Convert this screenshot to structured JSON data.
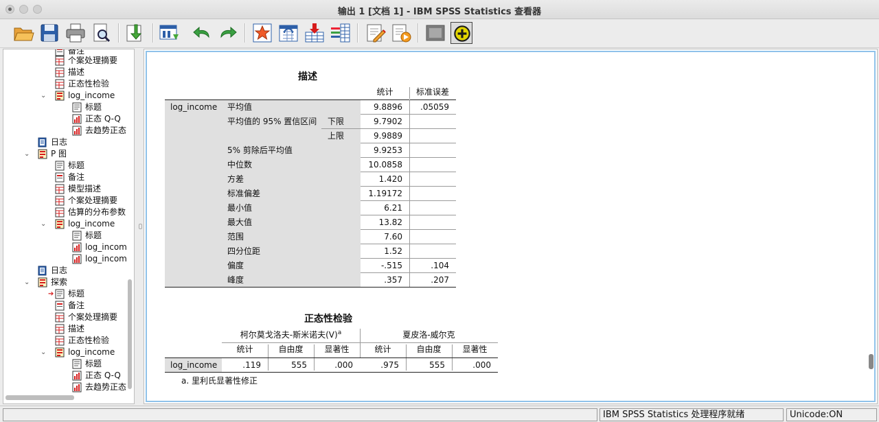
{
  "window": {
    "title": "输出 1 [文档 1] - IBM SPSS Statistics 查看器"
  },
  "toolbar": {
    "buttons": [
      "open-icon",
      "save-icon",
      "print-icon",
      "print-preview-icon",
      "export-icon",
      "goto-data-icon",
      "undo-icon",
      "redo-icon",
      "goto-case-icon",
      "goto-variable-icon",
      "insert-cases-icon",
      "variables-icon",
      "script-icon",
      "run-script-icon",
      "designate-window-icon",
      "add-icon"
    ]
  },
  "navigator": {
    "nodes": [
      {
        "label": "备注"
      },
      {
        "label": "个案处理摘要"
      },
      {
        "label": "描述"
      },
      {
        "label": "正态性检验"
      },
      {
        "label": "log_income"
      },
      {
        "label": "标题"
      },
      {
        "label": "正态 Q-Q"
      },
      {
        "label": "去趋势正态"
      },
      {
        "label": "日志"
      },
      {
        "label": "P 图"
      },
      {
        "label": "标题"
      },
      {
        "label": "备注"
      },
      {
        "label": "模型描述"
      },
      {
        "label": "个案处理摘要"
      },
      {
        "label": "估算的分布参数"
      },
      {
        "label": "log_income"
      },
      {
        "label": "标题"
      },
      {
        "label": "log_incom"
      },
      {
        "label": "log_incom"
      },
      {
        "label": "日志"
      },
      {
        "label": "探索"
      },
      {
        "label": "标题"
      },
      {
        "label": "备注"
      },
      {
        "label": "个案处理摘要"
      },
      {
        "label": "描述"
      },
      {
        "label": "正态性检验"
      },
      {
        "label": "log_income"
      },
      {
        "label": "标题"
      },
      {
        "label": "正态 Q-Q"
      },
      {
        "label": "去趋势正态"
      }
    ]
  },
  "descriptives": {
    "title": "描述",
    "col_statistic": "统计",
    "col_std_error": "标准误差",
    "variable": "log_income",
    "ci_label": "平均值的 95% 置信区间",
    "rows": [
      {
        "label": "平均值",
        "stat": "9.8896",
        "se": ".05059"
      },
      {
        "label": "下限",
        "stat": "9.7902",
        "se": ""
      },
      {
        "label": "上限",
        "stat": "9.9889",
        "se": ""
      },
      {
        "label": "5% 剪除后平均值",
        "stat": "9.9253",
        "se": ""
      },
      {
        "label": "中位数",
        "stat": "10.0858",
        "se": ""
      },
      {
        "label": "方差",
        "stat": "1.420",
        "se": ""
      },
      {
        "label": "标准偏差",
        "stat": "1.19172",
        "se": ""
      },
      {
        "label": "最小值",
        "stat": "6.21",
        "se": ""
      },
      {
        "label": "最大值",
        "stat": "13.82",
        "se": ""
      },
      {
        "label": "范围",
        "stat": "7.60",
        "se": ""
      },
      {
        "label": "四分位距",
        "stat": "1.52",
        "se": ""
      },
      {
        "label": "偏度",
        "stat": "-.515",
        "se": ".104"
      },
      {
        "label": "峰度",
        "stat": ".357",
        "se": ".207"
      }
    ]
  },
  "normality": {
    "title": "正态性检验",
    "ks_header": "柯尔莫戈洛夫-斯米诺夫(V)",
    "ks_sup": "a",
    "sw_header": "夏皮洛-威尔克",
    "sub_headers": [
      "统计",
      "自由度",
      "显著性",
      "统计",
      "自由度",
      "显著性"
    ],
    "row_label": "log_income",
    "values": [
      ".119",
      "555",
      ".000",
      ".975",
      "555",
      ".000"
    ],
    "footnote": "a. 里利氏显著性修正"
  },
  "status": {
    "message": "IBM SPSS Statistics 处理程序就绪",
    "unicode": "Unicode:ON"
  }
}
